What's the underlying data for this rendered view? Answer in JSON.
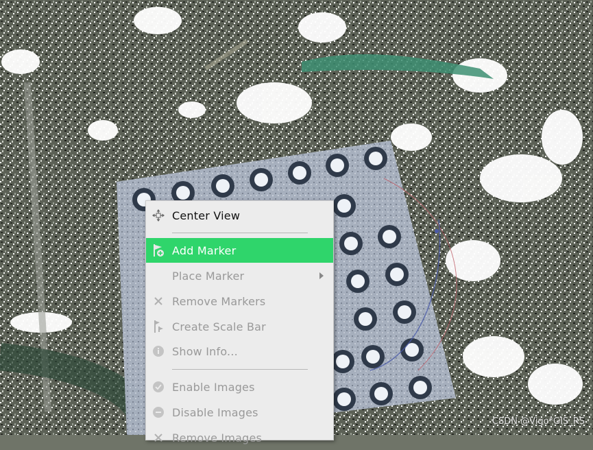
{
  "context_menu": {
    "items": [
      {
        "label": "Center View",
        "icon": "center-view-icon",
        "enabled": true,
        "highlighted": false
      },
      {
        "label": "Add Marker",
        "icon": "add-marker-icon",
        "enabled": true,
        "highlighted": true
      },
      {
        "label": "Place Marker",
        "icon": "",
        "enabled": false,
        "highlighted": false,
        "submenu": true
      },
      {
        "label": "Remove Markers",
        "icon": "close-icon",
        "enabled": false,
        "highlighted": false
      },
      {
        "label": "Create Scale Bar",
        "icon": "scale-bar-icon",
        "enabled": false,
        "highlighted": false
      },
      {
        "label": "Show Info...",
        "icon": "info-icon",
        "enabled": false,
        "highlighted": false
      },
      {
        "label": "Enable Images",
        "icon": "check-circle-icon",
        "enabled": false,
        "highlighted": false
      },
      {
        "label": "Disable Images",
        "icon": "minus-circle-icon",
        "enabled": false,
        "highlighted": false
      },
      {
        "label": "Remove Images",
        "icon": "close-icon",
        "enabled": false,
        "highlighted": false
      }
    ]
  },
  "colors": {
    "highlight": "#2fd56b",
    "menu_background": "#ececec",
    "disabled_text": "#999999",
    "enabled_text": "#111111"
  },
  "watermark": "CSDN @Vigo*GIS_RS"
}
